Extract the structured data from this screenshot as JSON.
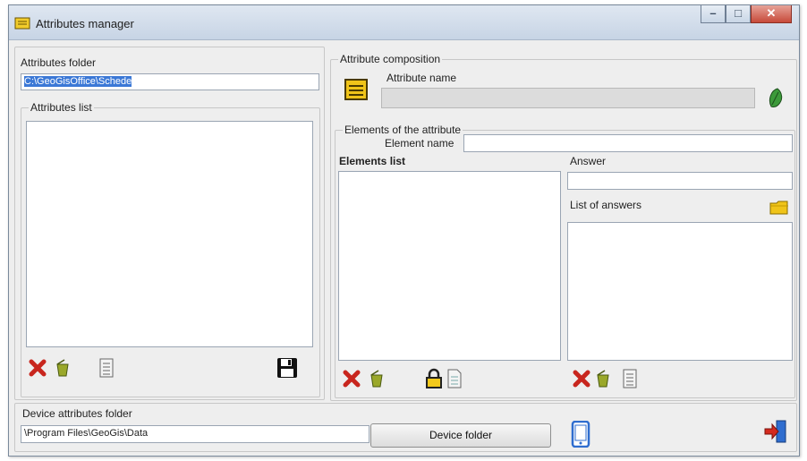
{
  "window": {
    "title": "Attributes manager"
  },
  "left": {
    "folder_label": "Attributes folder",
    "folder_value": "C:\\GeoGisOffice\\Schede",
    "list_legend": "Attributes list"
  },
  "composition": {
    "legend": "Attribute composition",
    "name_label": "Attribute name",
    "name_value": ""
  },
  "elements": {
    "legend": "Elements of the attribute",
    "element_name_label": "Element name",
    "element_name_value": "",
    "list_label": "Elements list",
    "answer_label": "Answer",
    "answer_value": "",
    "answers_list_label": "List of answers"
  },
  "device": {
    "folder_label": "Device attributes folder",
    "folder_value": "\\Program Files\\GeoGis\\Data",
    "button_label": "Device folder"
  },
  "colors": {
    "accent_red": "#c8261e",
    "folder_yellow": "#f0c419",
    "lock_yellow": "#f3c91b",
    "device_blue": "#2f6dcf"
  }
}
